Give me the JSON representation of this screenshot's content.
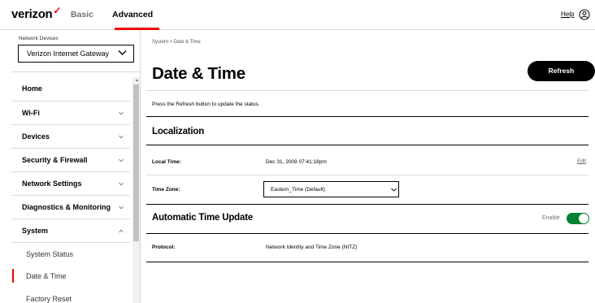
{
  "header": {
    "logo_text": "verizon",
    "logo_check": "✓",
    "tabs": [
      {
        "label": "Basic",
        "active": false
      },
      {
        "label": "Advanced",
        "active": true
      }
    ],
    "help_label": "Help",
    "accent_color": "#ee0000"
  },
  "sidebar": {
    "network_devices_label": "Network Devices",
    "device_select_value": "Verizon Internet Gateway",
    "items": [
      {
        "label": "Home"
      },
      {
        "label": "Wi-Fi"
      },
      {
        "label": "Devices"
      },
      {
        "label": "Security & Firewall"
      },
      {
        "label": "Network Settings"
      },
      {
        "label": "Diagnostics & Monitoring"
      },
      {
        "label": "System"
      }
    ],
    "subitems": [
      {
        "label": "System Status"
      },
      {
        "label": "Date & Time",
        "active": true
      },
      {
        "label": "Factory Reset"
      }
    ]
  },
  "main": {
    "breadcrumb": "System  >  Date & Time",
    "title": "Date & Time",
    "refresh_label": "Refresh",
    "hint": "Press the Refresh button to update the status.",
    "localization": {
      "title": "Localization",
      "local_time_label": "Local Time:",
      "local_time_value": "Dec 31, 2009 07:41:18pm",
      "edit_label": "Edit",
      "time_zone_label": "Time Zone:",
      "time_zone_value": "Eastern_Time (Default)"
    },
    "auto_update": {
      "title": "Automatic Time Update",
      "enable_label": "Enable",
      "enabled": true,
      "toggle_color": "#008331",
      "protocol_label": "Protocol:",
      "protocol_value": "Network Identity and Time Zone (NITZ)"
    }
  }
}
